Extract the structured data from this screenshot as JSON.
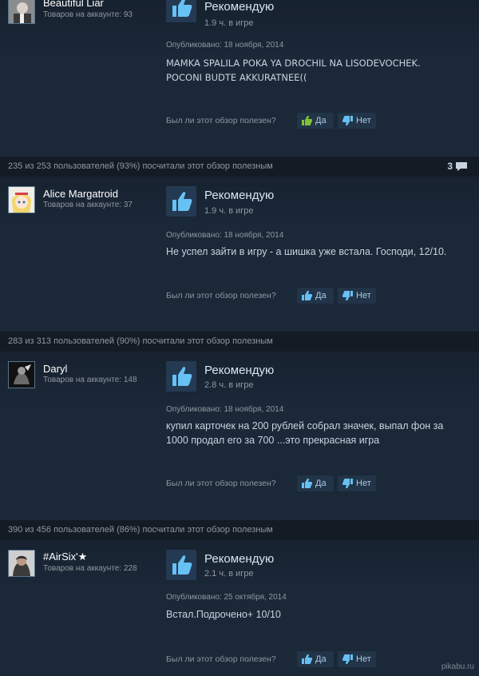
{
  "reviews": [
    {
      "helpful_count": "",
      "comments": "",
      "author": "Beautiful Liar",
      "products": "Товаров на аккаунте: 93",
      "verdict": "Рекомендую",
      "hours": "1.9 ч. в игре",
      "posted": "Опубликовано: 18 ноября, 2014",
      "content": "MAMKA SPALILA POKA YA DROCHIL NA LISODEVOCHEK. POCONI BUDTE AKKURATNEE((",
      "question": "Был ли этот обзор полезен?",
      "yes": "Да",
      "no": "Нет"
    },
    {
      "helpful_count": "235 из 253 пользователей (93%) посчитали этот обзор полезным",
      "comments": "3",
      "author": "Alice Margatroid",
      "products": "Товаров на аккаунте: 37",
      "verdict": "Рекомендую",
      "hours": "1.9 ч. в игре",
      "posted": "Опубликовано: 18 ноября, 2014",
      "content": "Не успел зайти в игру - а шишка уже встала. Господи, 12/10.",
      "question": "Был ли этот обзор полезен?",
      "yes": "Да",
      "no": "Нет"
    },
    {
      "helpful_count": "283 из 313 пользователей (90%) посчитали этот обзор полезным",
      "comments": "",
      "author": "Daryl",
      "products": "Товаров на аккаунте: 148",
      "verdict": "Рекомендую",
      "hours": "2.8 ч. в игре",
      "posted": "Опубликовано: 18 ноября, 2014",
      "content": "купил карточек на 200 рублей собрал значек, выпал фон за 1000 продал его за 700 ...это прекрасная игра",
      "question": "Был ли этот обзор полезен?",
      "yes": "Да",
      "no": "Нет"
    },
    {
      "helpful_count": "390 из 456 пользователей (86%) посчитали этот обзор полезным",
      "comments": "",
      "author": "#AirSix'★",
      "products": "Товаров на аккаунте: 228",
      "verdict": "Рекомендую",
      "hours": "2.1 ч. в игре",
      "posted": "Опубликовано: 25 октября, 2014",
      "content": "Встал.Подрочено+ 10/10",
      "question": "Был ли этот обзор полезен?",
      "yes": "Да",
      "no": "Нет"
    }
  ],
  "watermark": "pikabu.ru",
  "colors": {
    "background": "#1b2838",
    "accent": "#66c0f4",
    "thumb": "#67c1f5"
  },
  "icons": {
    "recommend": "thumbs-up-icon",
    "yes": "thumbs-up-icon",
    "no": "thumbs-down-icon",
    "comments": "speech-bubble-icon"
  }
}
